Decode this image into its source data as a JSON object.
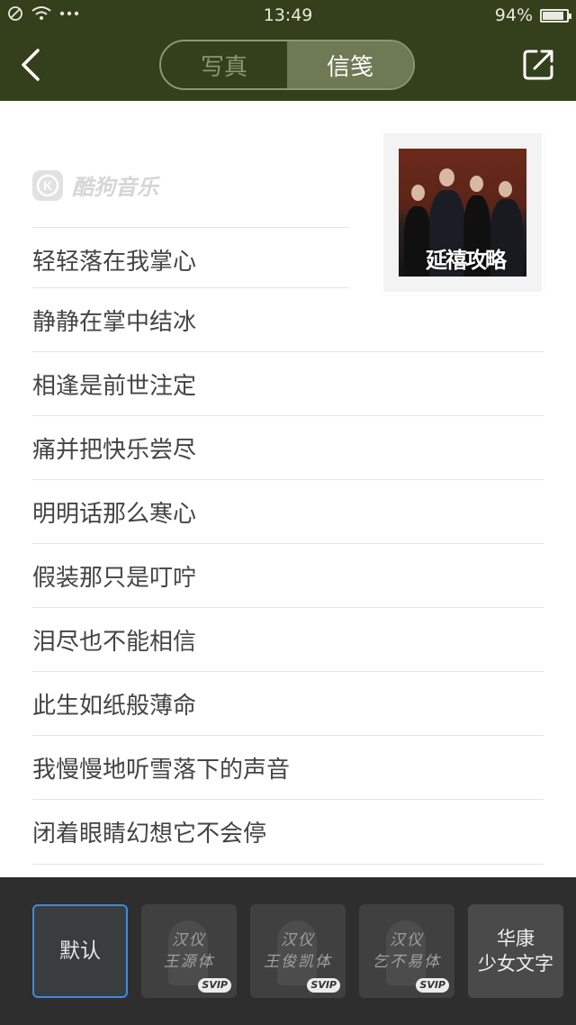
{
  "status_bar": {
    "time": "13:49",
    "battery": "94%",
    "battery_level": 0.94,
    "icons": [
      "block-icon",
      "wifi-icon",
      "more-dots-icon"
    ]
  },
  "header": {
    "tabs": [
      {
        "label": "写真",
        "active": false
      },
      {
        "label": "信笺",
        "active": true
      }
    ],
    "back_icon": "chevron-left-icon",
    "share_icon": "share-external-icon",
    "background": "#343f1b"
  },
  "brand": {
    "logo_letter": "K",
    "name": "酷狗音乐"
  },
  "album_stamp": {
    "title_art": "延禧攻略"
  },
  "lyrics": [
    "轻轻落在我掌心",
    "静静在掌中结冰",
    "相逢是前世注定",
    "痛并把快乐尝尽",
    "明明话那么寒心",
    "假装那只是叮咛",
    "泪尽也不能相信",
    "此生如纸般薄命",
    "我慢慢地听雪落下的声音",
    "闭着眼睛幻想它不会停"
  ],
  "font_picker": {
    "items": [
      {
        "label": "默认",
        "selected": true
      },
      {
        "line1": "汉仪",
        "line2": "王源体",
        "badge": "SVIP"
      },
      {
        "line1": "汉仪",
        "line2": "王俊凯体",
        "badge": "SVIP"
      },
      {
        "line1": "汉仪",
        "line2": "乞不易体",
        "badge": "SVIP"
      },
      {
        "line1": "华康",
        "line2": "少女文字"
      }
    ],
    "accent": "#3c8be0"
  }
}
